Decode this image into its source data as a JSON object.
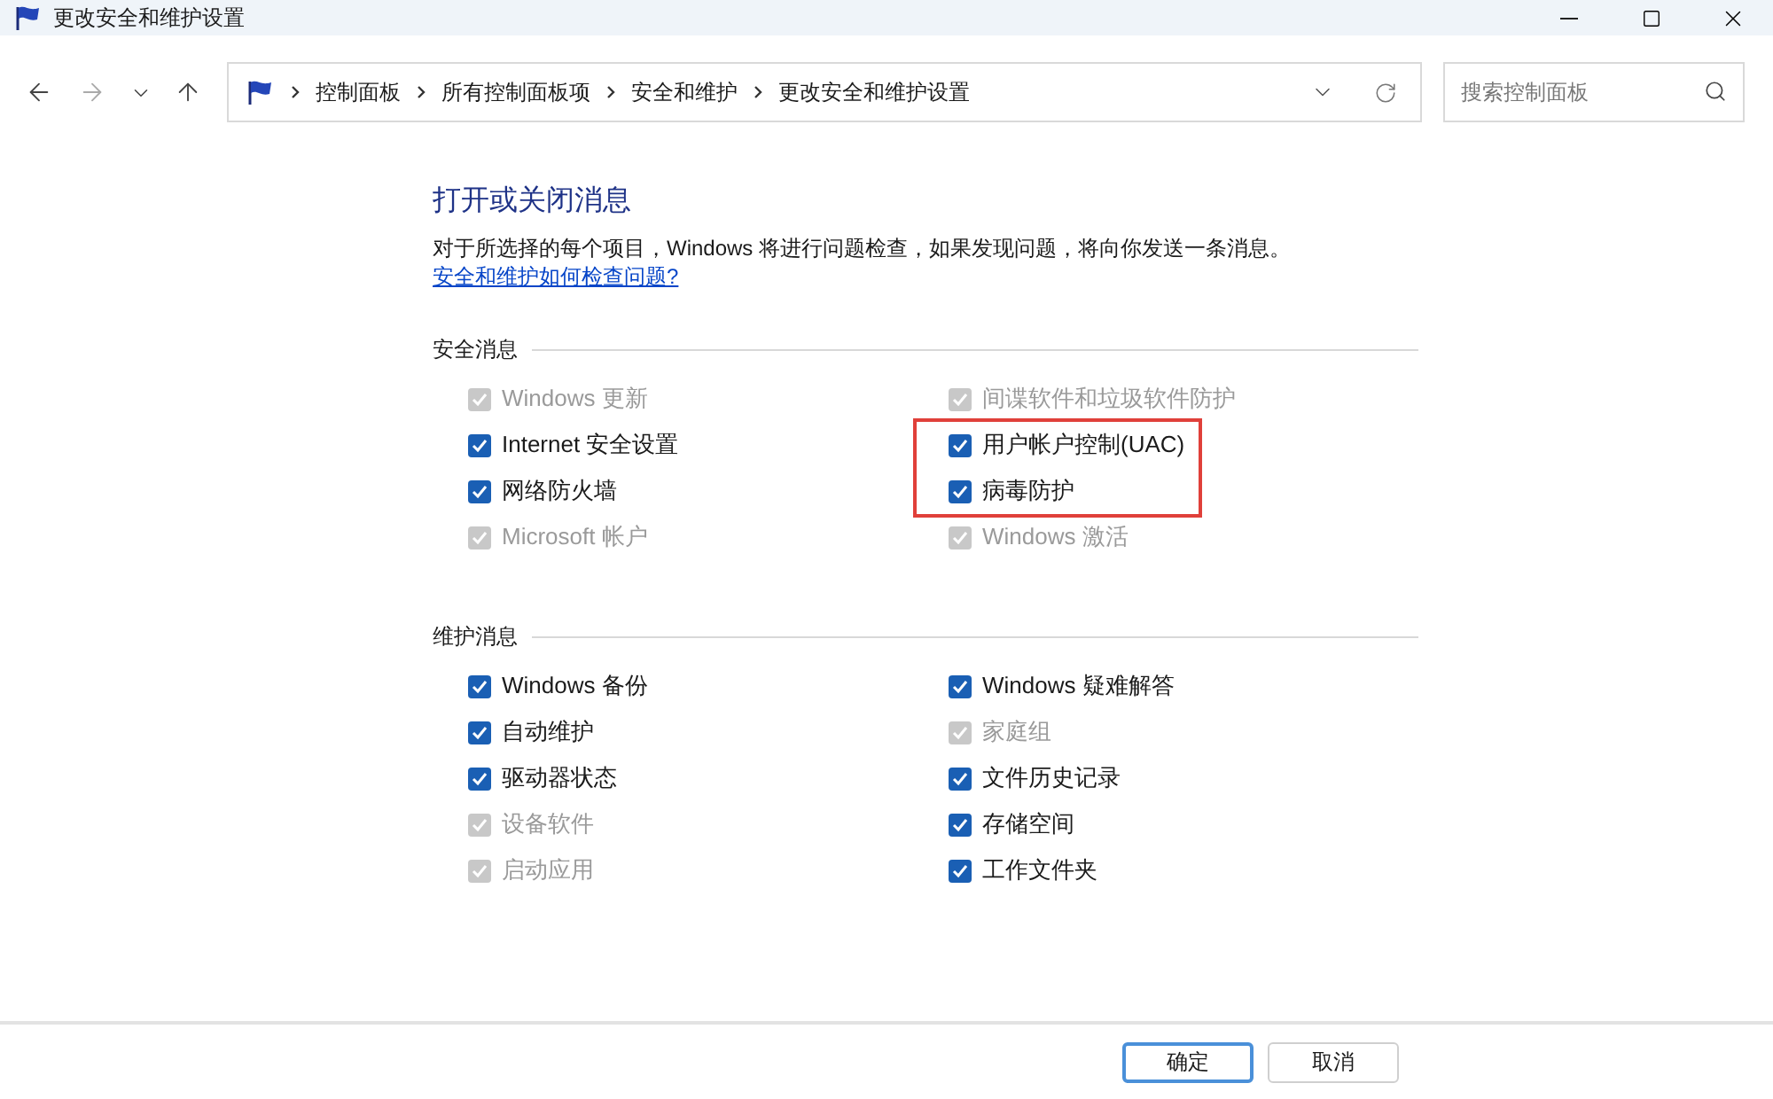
{
  "window": {
    "title": "更改安全和维护设置"
  },
  "breadcrumb": [
    "控制面板",
    "所有控制面板项",
    "安全和维护",
    "更改安全和维护设置"
  ],
  "search": {
    "placeholder": "搜索控制面板"
  },
  "heading": "打开或关闭消息",
  "description": "对于所选择的每个项目，Windows 将进行问题检查，如果发现问题，将向你发送一条消息。",
  "help_link": "安全和维护如何检查问题?",
  "sections": [
    {
      "title": "安全消息",
      "items": [
        {
          "label": "Windows 更新",
          "checked": true,
          "disabled": true,
          "highlighted": false
        },
        {
          "label": "间谍软件和垃圾软件防护",
          "checked": true,
          "disabled": true,
          "highlighted": false
        },
        {
          "label": "Internet 安全设置",
          "checked": true,
          "disabled": false,
          "highlighted": false
        },
        {
          "label": "用户帐户控制(UAC)",
          "checked": true,
          "disabled": false,
          "highlighted": true
        },
        {
          "label": "网络防火墙",
          "checked": true,
          "disabled": false,
          "highlighted": false
        },
        {
          "label": "病毒防护",
          "checked": true,
          "disabled": false,
          "highlighted": true
        },
        {
          "label": "Microsoft 帐户",
          "checked": true,
          "disabled": true,
          "highlighted": false
        },
        {
          "label": "Windows 激活",
          "checked": true,
          "disabled": true,
          "highlighted": false
        }
      ]
    },
    {
      "title": "维护消息",
      "items": [
        {
          "label": "Windows 备份",
          "checked": true,
          "disabled": false,
          "highlighted": false
        },
        {
          "label": "Windows 疑难解答",
          "checked": true,
          "disabled": false,
          "highlighted": false
        },
        {
          "label": "自动维护",
          "checked": true,
          "disabled": false,
          "highlighted": false
        },
        {
          "label": "家庭组",
          "checked": true,
          "disabled": true,
          "highlighted": false
        },
        {
          "label": "驱动器状态",
          "checked": true,
          "disabled": false,
          "highlighted": false
        },
        {
          "label": "文件历史记录",
          "checked": true,
          "disabled": false,
          "highlighted": false
        },
        {
          "label": "设备软件",
          "checked": true,
          "disabled": true,
          "highlighted": false
        },
        {
          "label": "存储空间",
          "checked": true,
          "disabled": false,
          "highlighted": false
        },
        {
          "label": "启动应用",
          "checked": true,
          "disabled": true,
          "highlighted": false
        },
        {
          "label": "工作文件夹",
          "checked": true,
          "disabled": false,
          "highlighted": false
        }
      ]
    }
  ],
  "buttons": [
    {
      "label": "确定",
      "kind": "default"
    },
    {
      "label": "取消",
      "kind": "normal"
    }
  ]
}
